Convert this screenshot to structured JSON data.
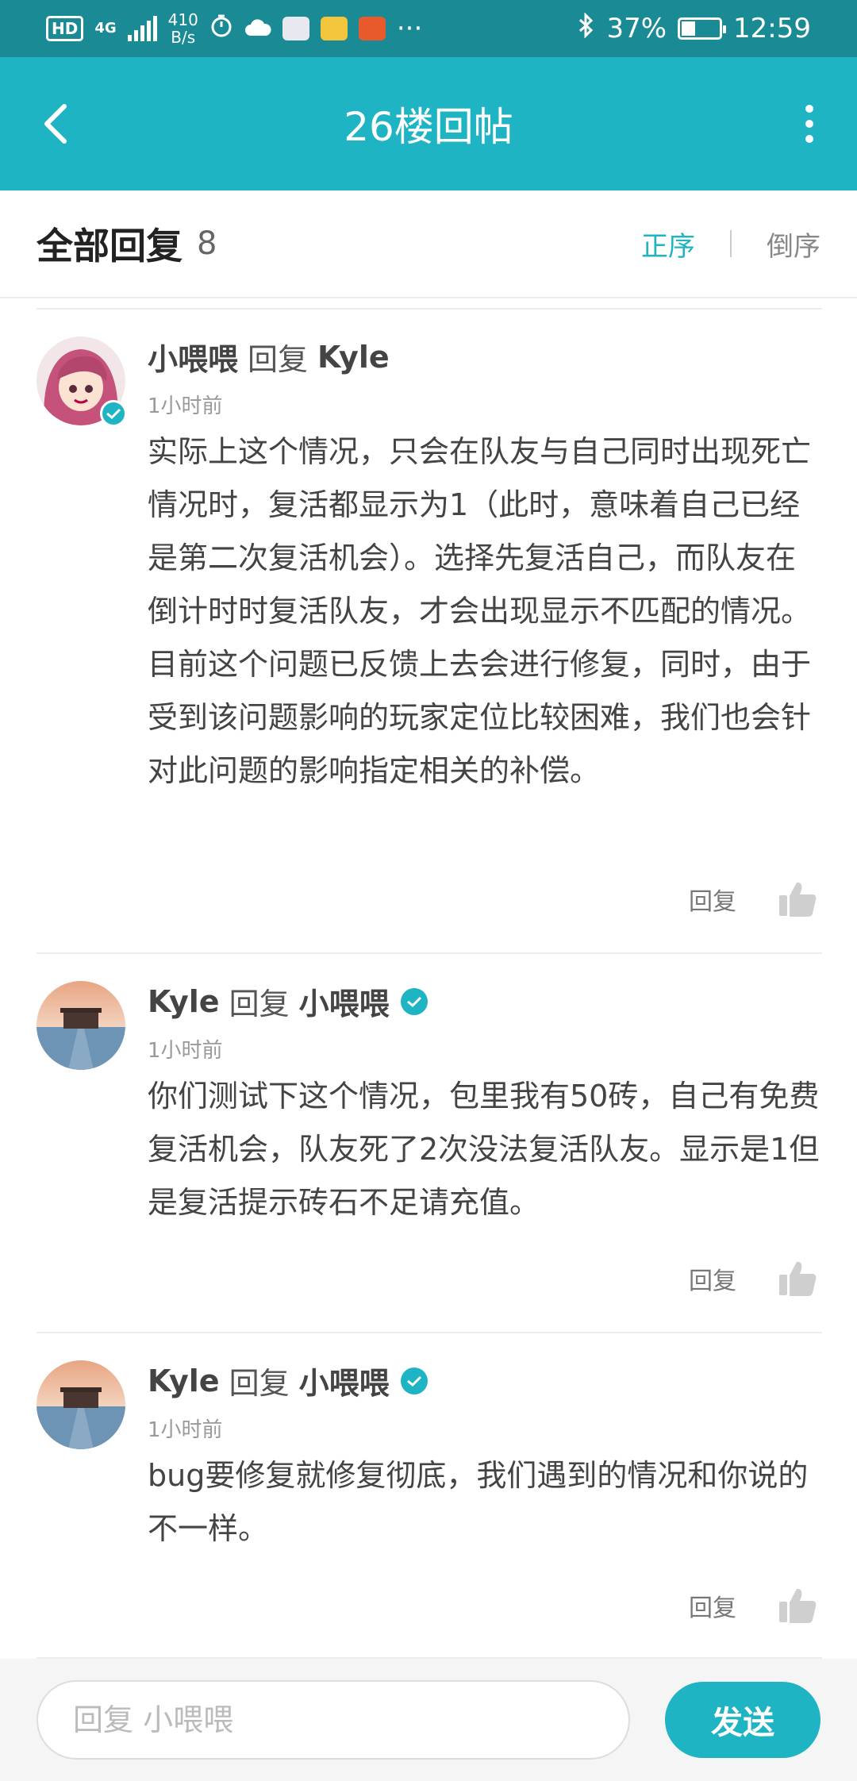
{
  "status_bar": {
    "hd": "HD",
    "network": "4G",
    "speed_value": "410",
    "speed_unit": "B/s",
    "more_indicator": "···",
    "battery": "37%",
    "battery_level": 0.37,
    "time": "12:59"
  },
  "app_bar": {
    "title": "26楼回帖"
  },
  "replies_header": {
    "title": "全部回复",
    "count": "8",
    "sort_asc": "正序",
    "sort_desc": "倒序"
  },
  "comments": [
    {
      "user": "小喂喂",
      "reply_word": "回复",
      "target": "Kyle",
      "time": "1小时前",
      "paragraphs": [
        "实际上这个情况，只会在队友与自己同时出现死亡情况时，复活都显示为1（此时，意味着自己已经是第二次复活机会）。选择先复活自己，而队友在倒计时时复活队友，才会出现显示不匹配的情况。",
        "目前这个问题已反馈上去会进行修复，同时，由于受到该问题影响的玩家定位比较困难，我们也会针对此问题的影响指定相关的补偿。"
      ],
      "reply_label": "回复"
    },
    {
      "user": "Kyle",
      "reply_word": "回复",
      "target": "小喂喂",
      "time": "1小时前",
      "paragraphs": [
        "你们测试下这个情况，包里我有50砖，自己有免费复活机会，队友死了2次没法复活队友。显示是1但是复活提示砖石不足请充值。"
      ],
      "reply_label": "回复"
    },
    {
      "user": "Kyle",
      "reply_word": "回复",
      "target": "小喂喂",
      "time": "1小时前",
      "paragraphs": [
        "bug要修复就修复彻底，我们遇到的情况和你说的不一样。"
      ],
      "reply_label": "回复"
    }
  ],
  "bottom_bar": {
    "input_placeholder": "回复 小喂喂",
    "send_label": "发送"
  },
  "colors": {
    "accent": "#1fb4c3",
    "status_bar": "#1a8a95",
    "text": "#444444",
    "muted": "#999999"
  }
}
